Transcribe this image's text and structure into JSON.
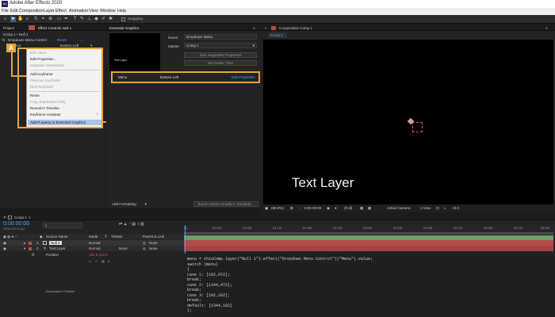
{
  "app": {
    "title": "Adobe After Effects 2020",
    "logo_text": "Ae"
  },
  "menubar": [
    "File",
    "Edit",
    "Composition",
    "Layer",
    "Effect",
    "Animation",
    "View",
    "Window",
    "Help"
  ],
  "toolbar": {
    "snapping_label": "Snapping"
  },
  "project_panel": {
    "tab_project": "Project",
    "tab_effect_controls": "Effect Controls Null 1",
    "header": "Comp 1 • Null 1",
    "effect_name": "Dropdown Menu Control",
    "reset_label": "Reset",
    "menu_prop": "Menu",
    "menu_value": "Bottom-Left"
  },
  "context_menu": {
    "items": [
      {
        "label": "Edit Value...",
        "state": "disabled"
      },
      {
        "label": "Edit Properties...",
        "state": "normal"
      },
      {
        "label": "Separate Dimensions",
        "state": "disabled"
      },
      {
        "label": "Add Keyframe",
        "state": "normal"
      },
      {
        "label": "Previous Keyframe",
        "state": "disabled"
      },
      {
        "label": "Next Keyframe",
        "state": "disabled"
      },
      {
        "label": "Reset",
        "state": "normal"
      },
      {
        "label": "Copy Expression Only",
        "state": "disabled"
      },
      {
        "label": "Reveal in Timeline",
        "state": "normal"
      },
      {
        "label": "Keyframe Assistant",
        "state": "normal"
      },
      {
        "label": "Add Property to Essential Graphics",
        "state": "highlighted"
      }
    ],
    "submenu_arrow": "›"
  },
  "callout_badge": "A",
  "essential_graphics": {
    "title": "Essential Graphics",
    "preview_text": "Text Layer",
    "name_label": "Name:",
    "name_value": "Dropdown Menu",
    "master_label": "Master:",
    "master_value": "Comp 1",
    "solo_button": "Solo Supported Properties",
    "poster_button": "Set Poster Time",
    "prop_name": "Menu",
    "prop_value": "Bottom-Left",
    "edit_properties": "Edit Properties",
    "add_formatting": "Add Formatting",
    "export_button": "Export Motion Graphics Template..."
  },
  "composition": {
    "tab_title": "Composition Comp 1",
    "subtab": "Comp 1",
    "viewer_text": "Text Layer",
    "zoom": "(68.9%)",
    "timecode": "0:00:00:00",
    "resolution": "(Full)",
    "camera": "Active Camera",
    "view": "1 View",
    "offset": "+0.0"
  },
  "timeline": {
    "comp_tab": "Comp 1",
    "timecode": "0:00:00:00",
    "fps": "00000 (30.00 fps)",
    "columns": {
      "source_name": "Source Name",
      "mode": "Mode",
      "t": "T",
      "trkmat": "TrkMat",
      "parent": "Parent & Link"
    },
    "layers": [
      {
        "num": "1",
        "name": "Null 1",
        "mode": "Normal",
        "trkmat": "",
        "parent": "None"
      },
      {
        "num": "2",
        "name": "Text Layer",
        "mode": "Normal",
        "trkmat": "None",
        "parent": "None"
      }
    ],
    "position_label": "Position",
    "position_value": "192.0,162.0",
    "expression_label": "Expression: Position",
    "ruler": [
      "0s",
      "00:12f",
      "01:00f",
      "01:12f",
      "02:00f",
      "02:12f",
      "03:00f",
      "03:12f",
      "04:00f",
      "04:12f",
      "05:00f",
      "05:12f",
      "06:00f",
      "06:12f",
      "07:00f"
    ],
    "expression_lines": [
      "menu = thisComp.layer(\"Null 1\").effect(\"Dropdown Menu Control\")(\"Menu\").value;",
      "switch (menu)",
      "{",
      "case 1: [192,972];",
      "break;",
      "case 2: [1344,972];",
      "break;",
      "case 3: [192,162];",
      "break;",
      "default: [1344,162]",
      "};"
    ]
  },
  "colors": {
    "accent": "#e7a23b",
    "selection_blue": "#4e9cff",
    "menu_highlight": "#a9c4e6",
    "layer_bar": "#b44a4a"
  }
}
